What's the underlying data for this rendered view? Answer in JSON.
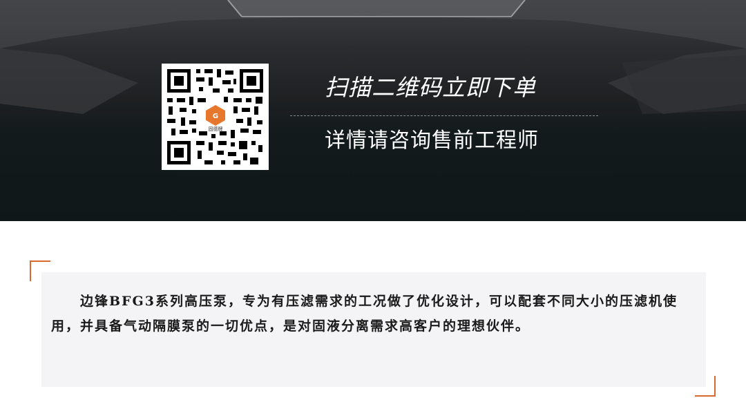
{
  "banner": {
    "headline": "扫描二维码立即下单",
    "subline": "详情请咨询售前工程师",
    "qr": {
      "logo_text": "固德牌",
      "logo_color": "#e8772e"
    }
  },
  "description": {
    "text": "边锋BFG3系列高压泵，专为有压滤需求的工况做了优化设计，可以配套不同大小的压滤机使用，并具备气动隔膜泵的一切优点，是对固液分离需求高客户的理想伙伴。"
  },
  "colors": {
    "accent": "#d9682e",
    "card_bg": "#f4f4f6",
    "banner_bg": "#1e2022"
  }
}
